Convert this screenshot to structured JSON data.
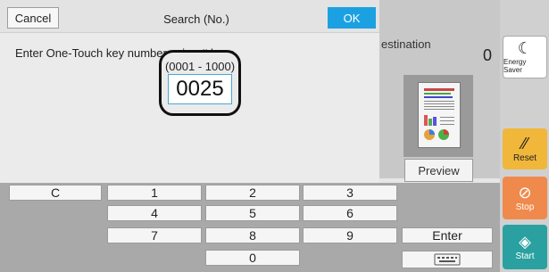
{
  "dialog": {
    "cancel_label": "Cancel",
    "title": "Search (No.)",
    "ok_label": "OK",
    "instruction": "Enter One-Touch key number using # keys.",
    "range": "(0001 - 1000)",
    "value": "0025"
  },
  "background": {
    "destination_label": "estination",
    "count": "0",
    "preview_label": "Preview"
  },
  "side_panel": {
    "energy_saver_label": "Energy Saver",
    "reset_label": "Reset",
    "stop_label": "Stop",
    "start_label": "Start"
  },
  "keypad": {
    "clear_label": "C",
    "k1": "1",
    "k2": "2",
    "k3": "3",
    "k4": "4",
    "k5": "5",
    "k6": "6",
    "k7": "7",
    "k8": "8",
    "k9": "9",
    "k0": "0",
    "enter_label": "Enter",
    "keyboard_icon": "keyboard-icon"
  },
  "colors": {
    "ok_blue": "#1ba1e2",
    "reset_yellow": "#f1b73a",
    "stop_orange": "#ef8a4c",
    "start_teal": "#2aa0a0"
  }
}
